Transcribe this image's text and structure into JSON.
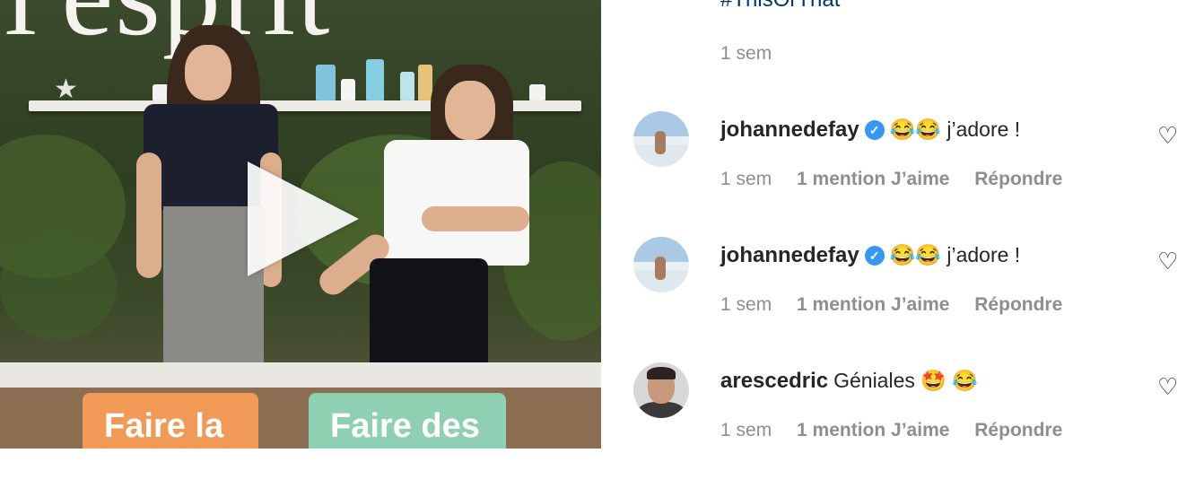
{
  "video": {
    "sign_text": "l'esprit",
    "caption_left": "Faire la",
    "caption_right": "Faire des"
  },
  "post": {
    "hashtag": "#ThisOrThat",
    "age": "1 sem"
  },
  "comments": [
    {
      "username": "johannedefay",
      "verified": true,
      "text": "😂😂 j’adore !",
      "age": "1 sem",
      "likes": "1 mention J’aime",
      "reply": "Répondre",
      "avatar": "beach-photo"
    },
    {
      "username": "johannedefay",
      "verified": true,
      "text": "😂😂 j’adore !",
      "age": "1 sem",
      "likes": "1 mention J’aime",
      "reply": "Répondre",
      "avatar": "beach-photo"
    },
    {
      "username": "arescedric",
      "verified": false,
      "text": "Géniales 🤩 😂",
      "age": "1 sem",
      "likes": "1 mention J’aime",
      "reply": "Répondre",
      "avatar": "man-portrait"
    }
  ],
  "icons": {
    "verified": "verified-badge-icon",
    "like": "heart-icon",
    "play": "play-icon"
  },
  "colors": {
    "link": "#00376b",
    "verified": "#3897f0",
    "muted": "#8e8e8e",
    "caption_orange": "#f19a58",
    "caption_mint": "#8fcfb2"
  }
}
